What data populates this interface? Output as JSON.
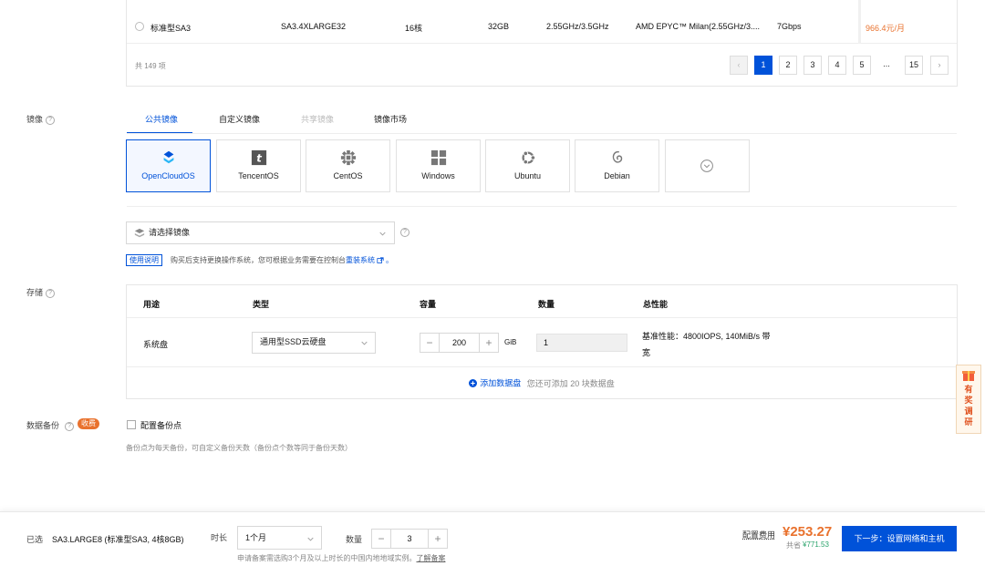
{
  "instance_row": {
    "name": "标准型SA3",
    "model": "SA3.4XLARGE32",
    "cpu": "16核",
    "memory": "32GB",
    "freq": "2.55GHz/3.5GHz",
    "processor": "AMD EPYC™ Milan(2.55GHz/3....",
    "bandwidth": "7Gbps",
    "price": "966.4元/月"
  },
  "pagination": {
    "total": "共 149 项",
    "prev": "‹",
    "pages": [
      "1",
      "2",
      "3",
      "4",
      "5",
      "...",
      "15"
    ],
    "active_page": "1",
    "next": "›"
  },
  "image": {
    "label": "镜像",
    "tabs": [
      "公共镜像",
      "自定义镜像",
      "共享镜像",
      "镜像市场"
    ],
    "os_options": [
      "OpenCloudOS",
      "TencentOS",
      "CentOS",
      "Windows",
      "Ubuntu",
      "Debian"
    ],
    "select_placeholder": "请选择镜像",
    "help_tag": "使用说明",
    "help_text": "购买后支持更换操作系统，您可根据业务需要在控制台",
    "help_link": "重装系统",
    "help_end": "。"
  },
  "storage": {
    "label": "存储",
    "headers": [
      "用途",
      "类型",
      "容量",
      "数量",
      "总性能"
    ],
    "row": {
      "usage": "系统盘",
      "type": "通用型SSD云硬盘",
      "size": "200",
      "unit": "GiB",
      "count": "1",
      "perf_line1": "基准性能：4800IOPS, 140MiB/s 带",
      "perf_line2": "宽"
    },
    "add_link": "添加数据盘",
    "add_note": "您还可添加 20 块数据盘"
  },
  "backup": {
    "label": "数据备份",
    "badge": "收费",
    "checkbox_label": "配置备份点",
    "note": "备份点为每天备份，可自定义备份天数（备份点个数等同于备份天数）"
  },
  "survey": {
    "chars": [
      "有",
      "奖",
      "调",
      "研"
    ]
  },
  "footer": {
    "selected_label": "已选",
    "selected_value": "SA3.LARGE8 (标准型SA3, 4核8GB)",
    "duration_label": "时长",
    "duration_value": "1个月",
    "quantity_label": "数量",
    "quantity_value": "3",
    "note": "申请备案需选购3个月及以上时长的中国内地地域实例。",
    "note_link": "了解备案",
    "fee_label": "配置费用",
    "price": "¥253.27",
    "save_label": "共省",
    "save_value": "¥771.53",
    "next_button": "下一步：设置网络和主机"
  },
  "colors": {
    "primary": "#0052d9",
    "price_orange": "#e9722e",
    "save_green": "#29a36a"
  }
}
